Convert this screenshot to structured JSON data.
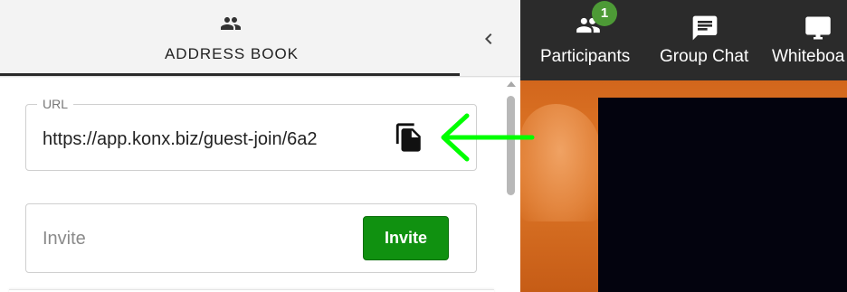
{
  "left_panel": {
    "tab": {
      "label": "ADDRESS BOOK",
      "icon": "people-icon"
    },
    "collapse_icon": "chevron-left-icon",
    "url_field": {
      "legend": "URL",
      "value": "https://app.konx.biz/guest-join/6a2",
      "copy_icon": "copy-document-icon"
    },
    "invite_field": {
      "placeholder": "Invite",
      "button_label": "Invite"
    }
  },
  "toolbar": {
    "items": [
      {
        "label": "Participants",
        "icon": "people-icon",
        "badge": "1"
      },
      {
        "label": "Group Chat",
        "icon": "chat-icon"
      },
      {
        "label": "Whiteboa",
        "icon": "whiteboard-icon"
      }
    ]
  },
  "colors": {
    "invite_button": "#109110",
    "badge": "#4d9a36",
    "toolbar_bg": "#2b2b2b",
    "annotation_arrow": "#00ff00"
  }
}
